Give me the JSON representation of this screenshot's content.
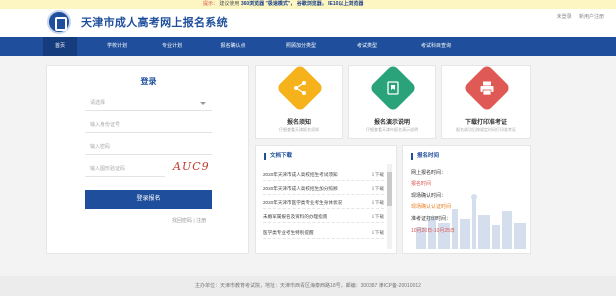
{
  "notice": {
    "prefix": "提示：",
    "text1": "建议使用",
    "browser": "360浏览器",
    "text2": "\"极速模式\"，",
    "text3": "谷歌浏览器，",
    "text4": "IE10以上浏览器"
  },
  "header": {
    "title": "天津市成人高考网上报名系统",
    "links": [
      "未登录",
      "新用户注册"
    ]
  },
  "nav": {
    "items": [
      "首页",
      "学校计划",
      "专业计划",
      "报名确认点",
      "照顾加分类型",
      "考试类型",
      "考试科目查询"
    ]
  },
  "login": {
    "title": "登录",
    "select_placeholder": "请选择",
    "id_placeholder": "输入身份证号",
    "password_placeholder": "输入密码",
    "captcha_placeholder": "输入图形验证码",
    "captcha_text": "AUC9",
    "button": "登录报名",
    "forgot": "找回密码",
    "separator": " | ",
    "register": "注册"
  },
  "cards": [
    {
      "title": "报名须知",
      "sub": "仔细查看天津报名须知",
      "icon": "share-nodes-icon",
      "color": "#f5b21a"
    },
    {
      "title": "报名演示说明",
      "sub": "仔细查看天津市报名演示说明",
      "icon": "flag-icon",
      "color": "#2aa37a"
    },
    {
      "title": "下载打印准考证",
      "sub": "报名成功后按规定时间打印准考证",
      "icon": "printer-icon",
      "color": "#e05a55"
    }
  ],
  "downloads": {
    "title": "文档下载",
    "download_label": "下载",
    "items": [
      "2020年天津市成人高校招生考试须知",
      "2020年天津市成人高校招生加分照顾",
      "2020年天津市医学类专业考生身体状况",
      "未婚军属报名及资料的办理指南",
      "医学类专业考生特别提醒"
    ]
  },
  "report_time": {
    "title": "报名时间",
    "lines": [
      {
        "text": "网上报名时间：",
        "kind": "lab"
      },
      {
        "text": "报名时间",
        "kind": "val"
      },
      {
        "text": "现场确认时间：",
        "kind": "lab"
      },
      {
        "text": "现场确认认证时间",
        "kind": "val2"
      },
      {
        "text": "准考证打印时间：",
        "kind": "lab"
      },
      {
        "text": "10月20日-10月25日",
        "kind": "val"
      }
    ]
  },
  "footer": "主办单位：天津市教育考试院，地址：天津市西青区海泰西路18号，邮编：300387 津ICP备-20010012"
}
